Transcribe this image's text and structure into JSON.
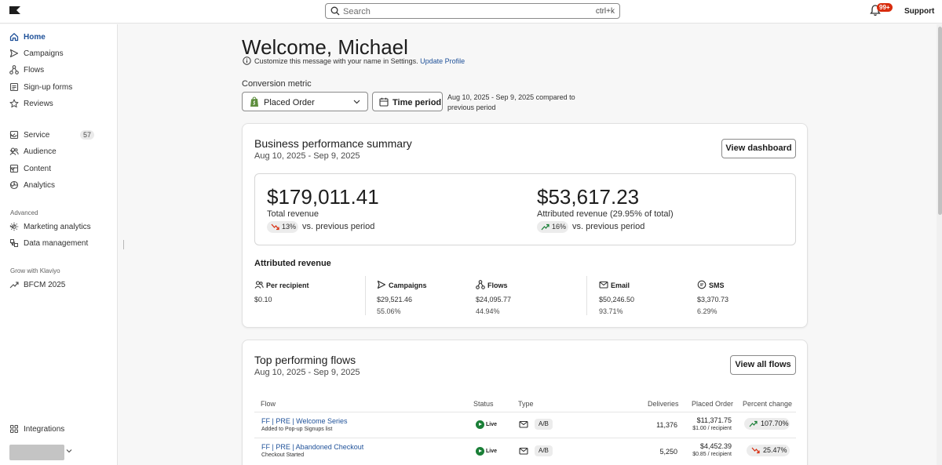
{
  "search": {
    "placeholder": "Search",
    "shortcut": "ctrl+k"
  },
  "header": {
    "notifications_badge": "99+",
    "support_label": "Support"
  },
  "sidebar": {
    "items": [
      {
        "label": "Home",
        "icon": "home-icon"
      },
      {
        "label": "Campaigns",
        "icon": "send-icon"
      },
      {
        "label": "Flows",
        "icon": "flows-icon"
      },
      {
        "label": "Sign-up forms",
        "icon": "form-icon"
      },
      {
        "label": "Reviews",
        "icon": "star-icon"
      }
    ],
    "groups": [
      {
        "label": "Service",
        "count": "57"
      },
      {
        "label": "Audience"
      },
      {
        "label": "Content"
      },
      {
        "label": "Analytics"
      }
    ],
    "advanced_heading": "Advanced",
    "advanced_items": [
      {
        "label": "Marketing analytics"
      },
      {
        "label": "Data management"
      }
    ],
    "grow_heading": "Grow with Klaviyo",
    "grow_items": [
      {
        "label": "BFCM 2025"
      }
    ],
    "integrations_label": "Integrations"
  },
  "main": {
    "welcome": "Welcome, Michael",
    "customize_text": "Customize this message with your name in Settings.",
    "customize_link": "Update Profile",
    "conversion_label": "Conversion metric",
    "metric_value": "Placed Order",
    "time_period_label": "Time period",
    "period_description": "Aug 10, 2025 - Sep 9, 2025 compared to previous period"
  },
  "summary": {
    "title": "Business performance summary",
    "date_range": "Aug 10, 2025 - Sep 9, 2025",
    "view_dashboard_label": "View dashboard",
    "total_revenue": "$179,011.41",
    "total_revenue_label": "Total revenue",
    "total_change": "13%",
    "total_change_direction": "down",
    "attributed_revenue": "$53,617.23",
    "attributed_revenue_label": "Attributed revenue (29.95% of total)",
    "attributed_change": "16%",
    "attributed_change_direction": "up",
    "vs_label": "vs. previous period",
    "attributed_heading": "Attributed revenue",
    "stats": [
      {
        "label": "Per recipient",
        "value": "$0.10",
        "pct": ""
      },
      {
        "label": "Campaigns",
        "value": "$29,521.46",
        "pct": "55.06%"
      },
      {
        "label": "Flows",
        "value": "$24,095.77",
        "pct": "44.94%"
      },
      {
        "label": "Email",
        "value": "$50,246.50",
        "pct": "93.71%"
      },
      {
        "label": "SMS",
        "value": "$3,370.73",
        "pct": "6.29%"
      }
    ]
  },
  "flows": {
    "title": "Top performing flows",
    "date_range": "Aug 10, 2025 - Sep 9, 2025",
    "view_all_label": "View all flows",
    "columns": [
      "Flow",
      "Status",
      "Type",
      "Deliveries",
      "Placed Order",
      "Percent change"
    ],
    "rows": [
      {
        "name": "FF | PRE | Welcome Series",
        "trigger": "Added to Pop-up Signups list",
        "status": "Live",
        "type": "A/B",
        "deliveries": "11,376",
        "placed_order": "$11,371.75",
        "per_recipient": "$1.00 / recipient",
        "change": "107.70%",
        "direction": "up"
      },
      {
        "name": "FF | PRE | Abandoned Checkout",
        "trigger": "Checkout Started",
        "status": "Live",
        "type": "A/B",
        "deliveries": "5,250",
        "placed_order": "$4,452.39",
        "per_recipient": "$0.85 / recipient",
        "change": "25.47%",
        "direction": "down"
      }
    ]
  },
  "colors": {
    "link": "#1f5199",
    "live": "#1a7f37",
    "down": "#d82c0d",
    "up": "#1a7f37",
    "badge": "#d82c0d"
  }
}
